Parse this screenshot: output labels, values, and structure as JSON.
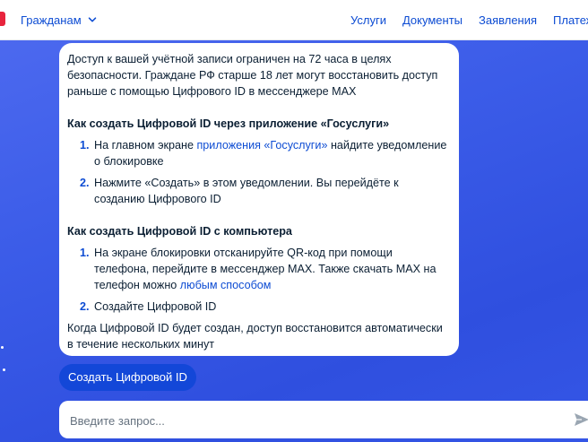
{
  "header": {
    "audience_label": "Гражданам",
    "nav": [
      "Услуги",
      "Документы",
      "Заявления",
      "Платежи"
    ]
  },
  "message": {
    "intro": "Доступ к вашей учётной записи ограничен на 72 часа в целях безопасности. Граждане РФ старше 18 лет могут восстановить доступ раньше с помощью Цифрового ID в мессенджере MAX",
    "app_section": {
      "title": "Как создать Цифровой ID через приложение «Госуслуги»",
      "steps": [
        {
          "num": "1.",
          "before": "На главном экране ",
          "link": "приложения «Госуслуги»",
          "after": " найдите уведомление о блокировке"
        },
        {
          "num": "2.",
          "text": "Нажмите «Создать» в этом уведомлении. Вы перейдёте к созданию Цифрового ID"
        }
      ]
    },
    "pc_section": {
      "title": "Как создать Цифровой ID с компьютера",
      "steps": [
        {
          "num": "1.",
          "before": "На экране блокировки отсканируйте QR-код при помощи телефона, перейдите в мессенджер MAX. Также скачать MAX на телефон можно ",
          "link": "любым способом"
        },
        {
          "num": "2.",
          "text": "Создайте Цифровой ID"
        }
      ]
    },
    "outro": "Когда Цифровой ID будет создан, доступ восстановится автоматически в течение нескольких минут"
  },
  "create_button": "Создать Цифровой ID",
  "input": {
    "placeholder": "Введите запрос...",
    "value": ""
  },
  "icons": {
    "audience_toggle": "chevron-down-icon",
    "send": "send-icon"
  },
  "colors": {
    "brand_blue": "#0d4cd3",
    "background_blue": "#3b5ce8",
    "logo_red": "#e8243d"
  }
}
